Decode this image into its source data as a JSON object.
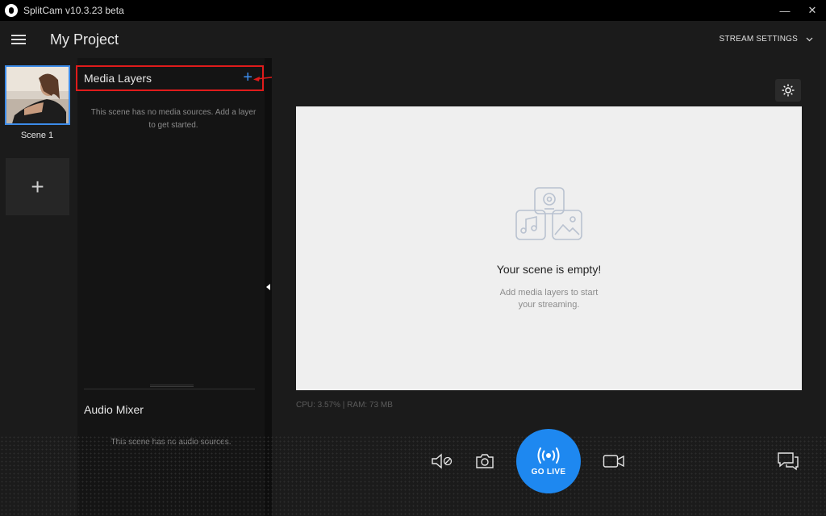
{
  "window": {
    "title": "SplitCam v10.3.23 beta",
    "minimize_glyph": "—",
    "close_glyph": "✕"
  },
  "header": {
    "project_title": "My Project",
    "stream_settings_label": "STREAM SETTINGS"
  },
  "scenes": {
    "items": [
      {
        "label": "Scene 1"
      }
    ],
    "add_glyph": "+"
  },
  "media_layers": {
    "title": "Media Layers",
    "add_glyph": "+",
    "empty_text": "This scene has no media sources. Add a layer to get started."
  },
  "audio_mixer": {
    "title": "Audio Mixer",
    "empty_text": "This scene has no audio sources."
  },
  "preview": {
    "empty_title": "Your scene is empty!",
    "empty_subtitle": "Add media layers to start your streaming.",
    "stats": "CPU: 3.57% | RAM: 73 MB"
  },
  "controls": {
    "go_live_label": "GO LIVE"
  },
  "colors": {
    "accent": "#1e88f0",
    "highlight": "#e01b1b"
  }
}
